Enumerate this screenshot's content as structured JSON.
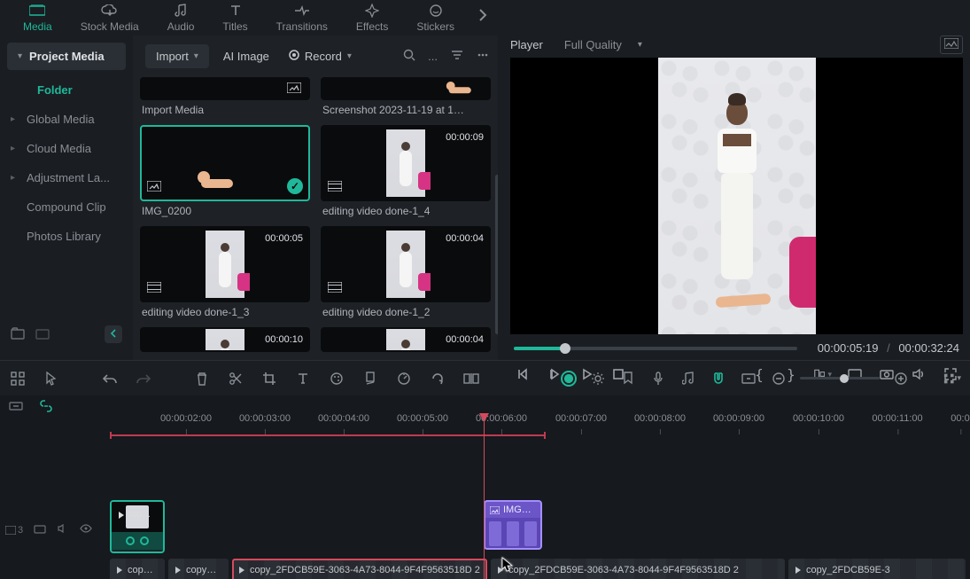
{
  "tabs": {
    "media": "Media",
    "stock_media": "Stock Media",
    "audio": "Audio",
    "titles": "Titles",
    "transitions": "Transitions",
    "effects": "Effects",
    "stickers": "Stickers"
  },
  "sidebar": {
    "header": "Project Media",
    "folder": "Folder",
    "items": [
      "Global Media",
      "Cloud Media",
      "Adjustment La...",
      "Compound Clip",
      "Photos Library"
    ]
  },
  "media_toolbar": {
    "import": "Import",
    "ai_image": "AI Image",
    "record": "Record",
    "ellipsis": "..."
  },
  "media_items": [
    {
      "name": "Import Media",
      "duration": "",
      "type": "image",
      "selected": false,
      "partial": true
    },
    {
      "name": "Screenshot 2023-11-19 at 1…",
      "duration": "",
      "type": "image",
      "selected": false,
      "partial": true
    },
    {
      "name": "IMG_0200",
      "duration": "",
      "type": "image",
      "selected": true
    },
    {
      "name": "editing video done-1_4",
      "duration": "00:00:09",
      "type": "video",
      "selected": false
    },
    {
      "name": "editing video done-1_3",
      "duration": "00:00:05",
      "type": "video",
      "selected": false
    },
    {
      "name": "editing video done-1_2",
      "duration": "00:00:04",
      "type": "video",
      "selected": false
    },
    {
      "name": "",
      "duration": "00:00:10",
      "type": "video",
      "selected": false,
      "partial": true
    },
    {
      "name": "",
      "duration": "00:00:04",
      "type": "video",
      "selected": false,
      "partial": true
    }
  ],
  "player": {
    "title": "Player",
    "quality": "Full Quality",
    "current": "00:00:05:19",
    "total": "00:00:32:24",
    "separator": "/"
  },
  "ruler": {
    "ticks": [
      "00:00:02:00",
      "00:00:03:00",
      "00:00:04:00",
      "00:00:05:00",
      "00:00:06:00",
      "00:00:07:00",
      "00:00:08:00",
      "00:00:09:00",
      "00:00:10:00",
      "00:00:11:00",
      "00:0"
    ]
  },
  "track_label": {
    "video_index": "3"
  },
  "clips": {
    "img_name": "IMG…",
    "teal_name": "cop…",
    "v1": "cop…",
    "v2": "copy…",
    "v3": "copy_2FDCB59E-3063-4A73-8044-9F4F9563518D 2",
    "v4": "copy_2FDCB59E-3063-4A73-8044-9F4F9563518D 2",
    "v5": "copy_2FDCB59E-3"
  },
  "colors": {
    "accent": "#1fb89a",
    "playhead": "#d64a5e",
    "clip_purple": "#6b55c7"
  }
}
